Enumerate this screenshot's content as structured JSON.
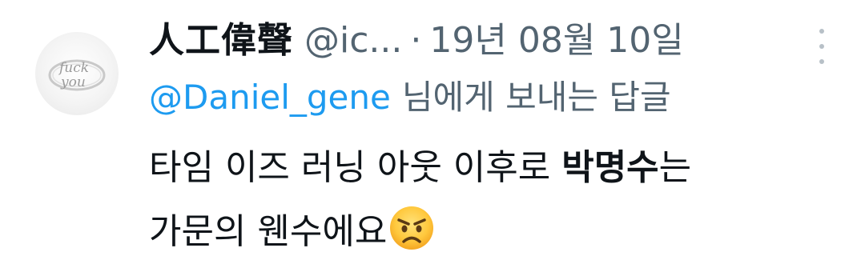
{
  "tweet": {
    "display_name": "人工偉聲",
    "handle": "@ic...",
    "separator": "·",
    "date": "19년 08월 10일",
    "reply": {
      "mention": "@Daniel_gene",
      "suffix": "님에게 보내는 답글"
    },
    "body": {
      "line1_prefix": "타임 이즈 러닝 아웃 이후로 ",
      "bold": "박명수",
      "line1_suffix": "는",
      "line2": "가문의 웬수에요"
    },
    "emoji": "angry-face-icon",
    "avatar_text": [
      "fuck",
      "you"
    ]
  },
  "colors": {
    "text": "#0f1419",
    "secondary": "#536471",
    "link": "#1d9bf0"
  }
}
